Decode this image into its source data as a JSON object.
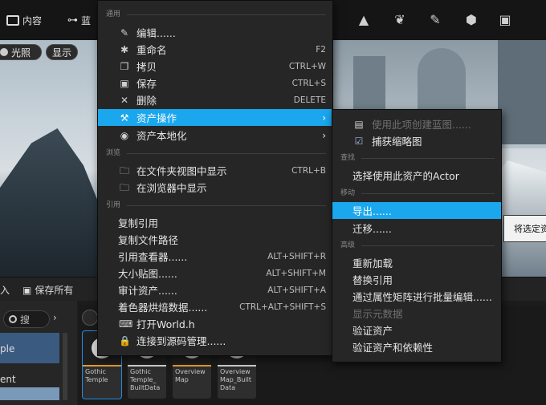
{
  "toolbar": {
    "content_label": "内容",
    "blueprint_label": "蓝",
    "icons": [
      "landscape-icon",
      "foliage-icon",
      "paint-icon",
      "fracture-icon",
      "modeling-icon"
    ]
  },
  "viewport": {
    "lit_label": "光照",
    "show_label": "显示"
  },
  "savebar": {
    "import_label": "入",
    "save_all_label": "保存所有"
  },
  "content_browser": {
    "search_placeholder": "搜",
    "folders": [
      "ple",
      "ent"
    ],
    "assets": [
      {
        "name": "Gothic Temple",
        "color": "#e39a2c"
      },
      {
        "name": "Gothic Temple_ BuiltData",
        "color": "#cfcfcf"
      },
      {
        "name": "Overview Map",
        "color": "#e39a2c"
      },
      {
        "name": "Overview Map_Built Data",
        "color": "#cfcfcf"
      }
    ]
  },
  "context_menu": {
    "sections": {
      "common": "通用",
      "browse": "浏览",
      "reference": "引用"
    },
    "items": [
      {
        "label": "编辑......",
        "shortcut": "",
        "icon": "edit-icon"
      },
      {
        "label": "重命名",
        "shortcut": "F2",
        "icon": "rename-icon"
      },
      {
        "label": "拷贝",
        "shortcut": "CTRL+W",
        "icon": "copy-icon"
      },
      {
        "label": "保存",
        "shortcut": "CTRL+S",
        "icon": "save-icon"
      },
      {
        "label": "删除",
        "shortcut": "DELETE",
        "icon": "delete-icon"
      },
      {
        "label": "资产操作",
        "shortcut": "",
        "icon": "wrench-icon"
      },
      {
        "label": "资产本地化",
        "shortcut": "",
        "icon": "globe-icon"
      },
      {
        "label": "在文件夹视图中显示",
        "shortcut": "CTRL+B",
        "icon": "folder-search-icon"
      },
      {
        "label": "在浏览器中显示",
        "shortcut": "",
        "icon": "folder-search-icon"
      },
      {
        "label": "复制引用",
        "shortcut": ""
      },
      {
        "label": "复制文件路径",
        "shortcut": ""
      },
      {
        "label": "引用查看器......",
        "shortcut": "ALT+SHIFT+R"
      },
      {
        "label": "大小贴图......",
        "shortcut": "ALT+SHIFT+M"
      },
      {
        "label": "审计资产......",
        "shortcut": "ALT+SHIFT+A"
      },
      {
        "label": "着色器烘焙数据......",
        "shortcut": "CTRL+ALT+SHIFT+S"
      },
      {
        "label": "打开World.h",
        "shortcut": "",
        "icon": "code-icon"
      },
      {
        "label": "连接到源码管理......",
        "shortcut": "",
        "icon": "lock-icon"
      }
    ]
  },
  "submenu": {
    "sections": {
      "find": "查找",
      "move": "移动",
      "advanced": "高级"
    },
    "items": [
      {
        "label": "使用此项创建蓝图......",
        "icon": "blueprint-icon"
      },
      {
        "label": "捕获缩略图",
        "icon": "checkbox-icon"
      },
      {
        "label": "选择使用此资产的Actor"
      },
      {
        "label": "导出......"
      },
      {
        "label": "迁移......"
      },
      {
        "label": "重新加载"
      },
      {
        "label": "替换引用"
      },
      {
        "label": "通过属性矩阵进行批量编辑......"
      },
      {
        "label": "显示元数据"
      },
      {
        "label": "验证资产"
      },
      {
        "label": "验证资产和依赖性"
      }
    ]
  },
  "tooltip": {
    "text": "将选定资"
  }
}
